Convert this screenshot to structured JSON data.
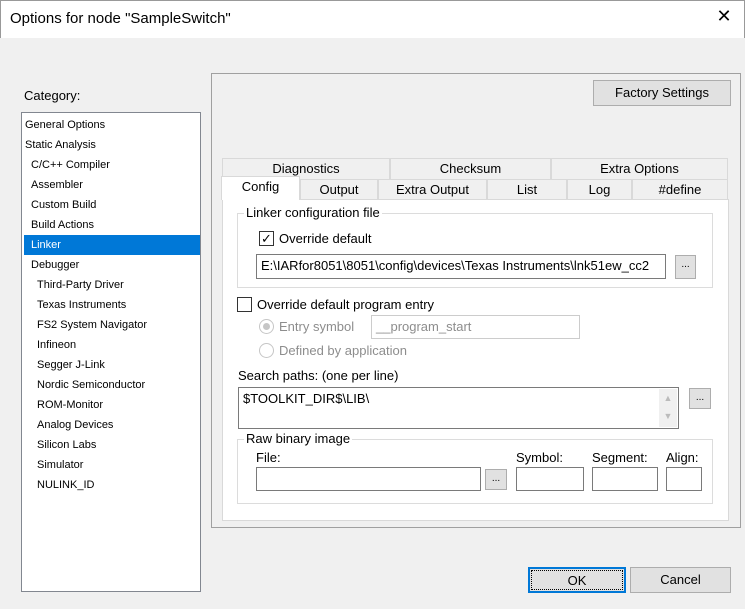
{
  "window": {
    "title": "Options for node \"SampleSwitch\"",
    "close": "✕"
  },
  "category": {
    "label": "Category:",
    "items": [
      "General Options",
      "Static Analysis",
      "C/C++ Compiler",
      "Assembler",
      "Custom Build",
      "Build Actions",
      "Linker",
      "Debugger",
      "Third-Party Driver",
      "Texas Instruments",
      "FS2 System Navigator",
      "Infineon",
      "Segger J-Link",
      "Nordic Semiconductor",
      "ROM-Monitor",
      "Analog Devices",
      "Silicon Labs",
      "Simulator",
      "NULINK_ID"
    ],
    "selected": "Linker"
  },
  "factory_settings": "Factory Settings",
  "tabs_row1": [
    "Diagnostics",
    "Checksum",
    "Extra Options"
  ],
  "tabs_row2": [
    "Config",
    "Output",
    "Extra Output",
    "List",
    "Log",
    "#define"
  ],
  "active_tab": "Config",
  "config": {
    "linker_group": "Linker configuration file",
    "override_default": "Override default",
    "override_default_checked": true,
    "config_path": "E:\\IARfor8051\\8051\\config\\devices\\Texas Instruments\\lnk51ew_cc2",
    "browse": "...",
    "override_entry": "Override default program entry",
    "override_entry_checked": false,
    "entry_symbol": "Entry symbol",
    "entry_symbol_value": "__program_start",
    "defined_by_app": "Defined by application",
    "search_label": "Search paths:  (one per line)",
    "search_value": "$TOOLKIT_DIR$\\LIB\\",
    "raw_group": "Raw binary image",
    "file": "File:",
    "symbol": "Symbol:",
    "segment": "Segment:",
    "align": "Align:",
    "file_value": "",
    "symbol_value": "",
    "segment_value": "",
    "align_value": ""
  },
  "ok": "OK",
  "cancel": "Cancel"
}
